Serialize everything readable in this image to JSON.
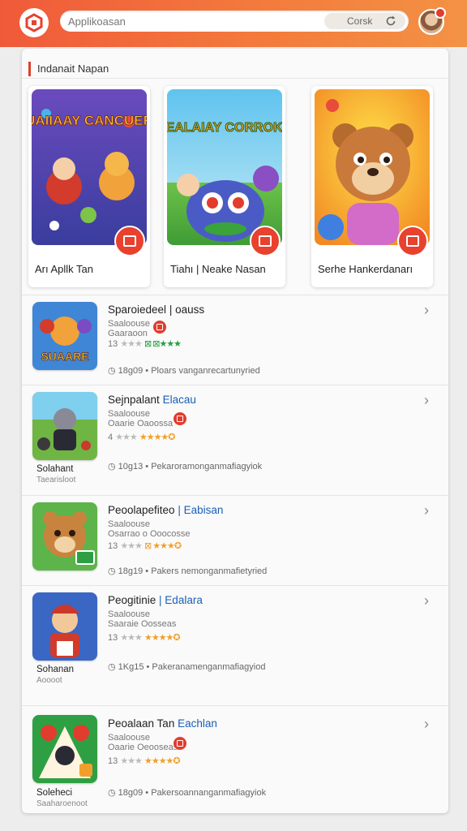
{
  "search": {
    "placeholder": "Applikoasan",
    "button_label": "Corsk"
  },
  "section": {
    "title": "Indanait Napan"
  },
  "featured": [
    {
      "label": "Arı    Apllk Tan",
      "art_text": "SUAIIAAY CANCUERS"
    },
    {
      "label": "Tiahı | Neake Nasan",
      "art_text": "FEALAIAY CORROKS"
    },
    {
      "label": "Serhe Hankerdanarı",
      "art_text": ""
    }
  ],
  "list": [
    {
      "title": "Sparoiedeel",
      "title_accent": " | oauss",
      "sub1": "Saaloouse",
      "sub2": "Gaaraoon",
      "rating_prefix": "13",
      "rating_style": "green",
      "meta": "18g09 • Ploars vanganrecartunyried",
      "icon_text": "SUAARE",
      "caption": "",
      "caption_sub": ""
    },
    {
      "title": "Sejnpalant",
      "title_accent": " Elacau",
      "sub1": "Saaloouse",
      "sub2": "Oaarie Oaoossa",
      "rating_prefix": "4",
      "rating_style": "orange",
      "meta": "10g13 • Pekaroramonganmafiagyiok",
      "icon_text": "",
      "caption": "Solahant",
      "caption_sub": "Taearisloot"
    },
    {
      "title": "Peoolapefiteo",
      "title_accent": " | Eabisan",
      "sub1": "Saaloouse",
      "sub2": "Osarrao o Ooocosse",
      "rating_prefix": "13",
      "rating_style": "orange",
      "meta": "18g19 • Pakers nemonganmafietyried",
      "icon_text": "",
      "caption": "",
      "caption_sub": ""
    },
    {
      "title": "Peogitinie",
      "title_accent": " | Edalara",
      "sub1": "Saaloouse",
      "sub2": "Saaraie Oosseas",
      "rating_prefix": "13",
      "rating_style": "orange",
      "meta": "1Kg15 • Pakeranamenganmafiagyiod",
      "icon_text": "",
      "caption": "Sohanan",
      "caption_sub": "Aoooot"
    },
    {
      "title": "Peoalaan Tan",
      "title_accent": " Eachlan",
      "sub1": "Saaloouse",
      "sub2": "Oaarie Oeooseas",
      "rating_prefix": "13",
      "rating_style": "orange",
      "meta": "18g09 • Pakersoannanganmafiagyiok",
      "icon_text": "",
      "caption": "Soleheci",
      "caption_sub": "Saaharoenoot"
    }
  ],
  "colors": {
    "header_start": "#f05a3a",
    "header_end": "#f39244",
    "accent_red": "#e8412e",
    "link_blue": "#1a5fb4",
    "star": "#f0a02a"
  },
  "icons": {
    "logo": "app-logo-icon",
    "refresh": "refresh-icon",
    "chevron": "chevron-right-icon",
    "star": "star-icon"
  }
}
